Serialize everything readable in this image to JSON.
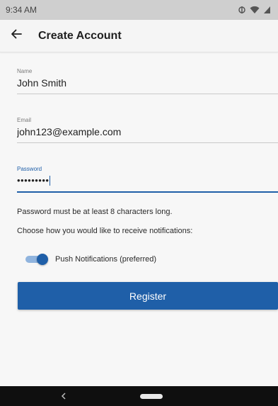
{
  "status_bar": {
    "time": "9:34 AM",
    "icons": [
      "sync-icon",
      "wifi-icon",
      "signal-icon"
    ]
  },
  "app_bar": {
    "title": "Create Account",
    "back_icon": "arrow-left-icon"
  },
  "form": {
    "name": {
      "label": "Name",
      "value": "John Smith"
    },
    "email": {
      "label": "Email",
      "value": "john123@example.com"
    },
    "password": {
      "label": "Password",
      "value": "•••••••••"
    }
  },
  "password_hint": "Password must be at least 8 characters long.",
  "notification_prompt": "Choose how you would like to receive notifications:",
  "push_toggle": {
    "label": "Push Notifications (preferred)",
    "on": true
  },
  "register_button": {
    "label": "Register"
  },
  "colors": {
    "accent": "#1f5fa8",
    "status_bar": "#cfcfcf",
    "background": "#f7f7f7",
    "nav_bar": "#0f0f0f"
  }
}
